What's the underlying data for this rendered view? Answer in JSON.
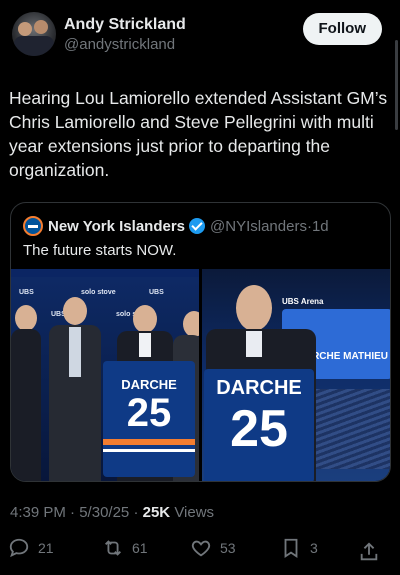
{
  "post": {
    "author_name": "Andy Strickland",
    "author_handle": "@andystrickland",
    "follow_label": "Follow",
    "text": "Hearing Lou Lamiorello extended Assistant GM’s Chris Lamiorello and Steve Pellegrini with multi year extensions just prior to departing the organization.",
    "time": "4:39 PM",
    "date": "5/30/25",
    "views_count": "25K",
    "views_label": "Views",
    "replies": "21",
    "reposts": "61",
    "likes": "53",
    "bookmarks": "3"
  },
  "quote": {
    "name": "New York Islanders",
    "handle": "@NYIslanders",
    "age": "1d",
    "text": "The future starts NOW."
  },
  "images": {
    "left": {
      "jersey_name": "DARCHE",
      "jersey_number": "25",
      "logos": [
        "UBS",
        "solo stove",
        "UBS",
        "UBS",
        "solo stove"
      ]
    },
    "right": {
      "jersey_name": "DARCHE",
      "jersey_number": "25",
      "arena_label": "UBS Arena",
      "screen_text": "DARCHE MATHIEU"
    }
  },
  "colors": {
    "background": "#000000",
    "text_primary": "#e7e9ea",
    "text_secondary": "#71767b",
    "border": "#2f3336",
    "verified": "#1d9bf0",
    "islanders_blue": "#0f3a86",
    "islanders_orange": "#f47d30"
  },
  "icons": {
    "reply": "reply-icon",
    "repost": "repost-icon",
    "like": "heart-icon",
    "bookmark": "bookmark-icon",
    "share": "share-icon",
    "verified": "verified-badge-icon"
  }
}
